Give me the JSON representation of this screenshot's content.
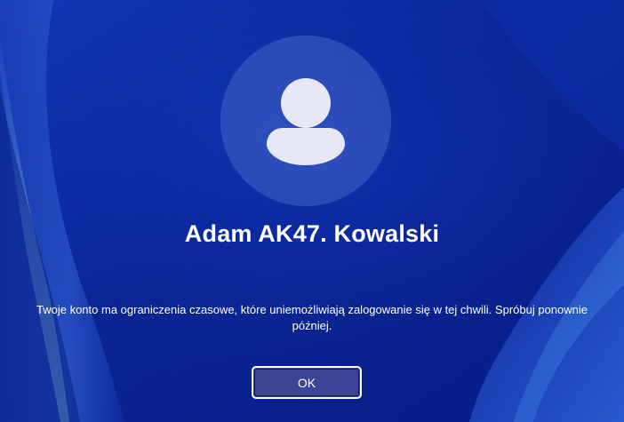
{
  "user": {
    "display_name": "Adam AK47. Kowalski",
    "avatar_icon": "user-silhouette-icon"
  },
  "dialog": {
    "message": "Twoje konto ma ograniczenia czasowe, które uniemożliwiają zalogowanie się w tej chwili. Spróbuj ponownie później.",
    "ok_label": "OK"
  },
  "colors": {
    "background": "#0a2596",
    "text": "#ffffff",
    "avatar_circle": "#3d55b8",
    "avatar_icon": "#e6e9f5"
  }
}
